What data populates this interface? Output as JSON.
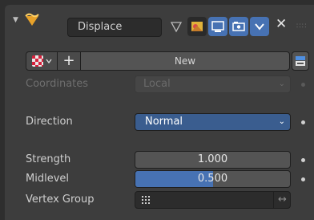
{
  "header": {
    "modifier_name": "Displace",
    "collapse_icon": "triangle-down-icon",
    "modifier_icon": "displace-modifier-icon",
    "edit_mode_icon": "triangle-vertex-icon",
    "cage_icon": "cage-icon",
    "viewport_icon": "monitor-icon",
    "render_icon": "camera-icon",
    "expand_icon": "chevron-down-icon",
    "close_icon": "close-icon",
    "grip_icon": "drag-grip-icon"
  },
  "texture": {
    "new_label": "New",
    "browse_icon": "checker-texture-icon",
    "add_icon": "plus-icon",
    "properties_icon": "texture-properties-icon"
  },
  "properties": {
    "coordinates": {
      "label": "Coordinates",
      "value": "Local",
      "enabled": false
    },
    "direction": {
      "label": "Direction",
      "value": "Normal"
    },
    "strength": {
      "label": "Strength",
      "value": "1.000"
    },
    "midlevel": {
      "label": "Midlevel",
      "value": "0.500",
      "fill_fraction": 0.5
    },
    "vertex_group": {
      "label": "Vertex Group",
      "value": "",
      "invert_icon": "swap-arrows-icon",
      "group_icon": "vertex-group-icon"
    }
  },
  "colors": {
    "accent": "#4772b3",
    "panel": "#3d3d3d",
    "background": "#2e2e2e"
  }
}
